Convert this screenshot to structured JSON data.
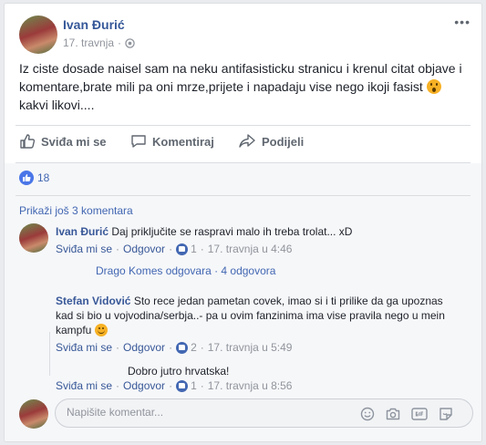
{
  "post": {
    "author": "Ivan Đurić",
    "date": "17. travnja",
    "text": "Iz ciste dosade naisel sam na neku antifasisticku stranicu i krenul citat objave i komentare,brate mili pa oni mrze,prijete i napadaju vise nego ikoji fasist",
    "text_tail": "kakvi likovi....",
    "menu": "•••"
  },
  "actions": {
    "like": "Sviđa mi se",
    "comment": "Komentiraj",
    "share": "Podijeli"
  },
  "reactions": {
    "count": "18"
  },
  "comments_section": {
    "view_more": "Prikaži još 3 komentara",
    "comments": [
      {
        "author": "Ivan Đurić",
        "text": "Daj priključite se raspravi malo ih treba trolat... xD",
        "like": "Sviđa mi se",
        "reply": "Odgovor",
        "likes": "1",
        "time": "17. travnja u 4:46",
        "replies_summary": "Drago Komes odgovara · 4 odgovora"
      },
      {
        "author": "Stefan Vidović",
        "text": "Sto rece jedan pametan covek, imao si i ti prilike da ga upoznas kad si bio u vojvodina/serbja..- pa u ovim fanzinima ima vise pravila nego u mein kampfu",
        "like": "Sviđa mi se",
        "reply": "Odgovor",
        "likes": "2",
        "time": "17. travnja u 5:49"
      },
      {
        "author": "",
        "text": "Dobro jutro hrvatska!",
        "like": "Sviđa mi se",
        "reply": "Odgovor",
        "likes": "1",
        "time": "17. travnja u 8:56"
      }
    ]
  },
  "composer": {
    "placeholder": "Napišite komentar..."
  },
  "colors": {
    "link": "#365899",
    "brand": "#4267b2",
    "muted": "#90949c",
    "emoji": "#f7b125"
  },
  "icons": [
    "thumbs-up-icon",
    "comment-icon",
    "share-icon",
    "like-reaction-icon",
    "emoji-icon",
    "camera-icon",
    "gif-icon",
    "sticker-icon",
    "globe-icon",
    "more-icon",
    "smile-emoji",
    "surprised-emoji"
  ]
}
